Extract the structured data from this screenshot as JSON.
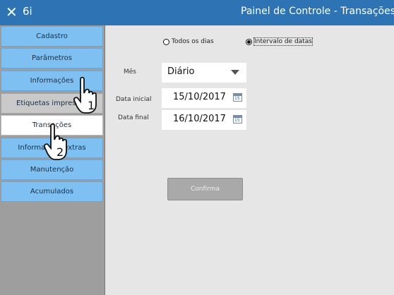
{
  "titlebar": {
    "close_glyph": "✕",
    "app_name": "6i",
    "window_title": "Painel de Controle - Transações"
  },
  "sidebar": {
    "items": [
      {
        "label": "Cadastro",
        "state": "normal"
      },
      {
        "label": "Parâmetros",
        "state": "normal"
      },
      {
        "label": "Informações",
        "state": "normal"
      },
      {
        "label": "Etiquetas impressas",
        "state": "gray"
      },
      {
        "label": "Transações",
        "state": "selected"
      },
      {
        "label": "Informações extras",
        "state": "normal"
      },
      {
        "label": "Manutenção",
        "state": "normal"
      },
      {
        "label": "Acumulados",
        "state": "normal"
      }
    ]
  },
  "filters": {
    "radio_all_days": "Todos os dias",
    "radio_date_range": "Intervalo de datas",
    "selected": "Intervalo de datas"
  },
  "form": {
    "month_label": "Mês",
    "month_value": "Diário",
    "start_label": "Data inicial",
    "start_value": "15/10/2017",
    "end_label": "Data final",
    "end_value": "16/10/2017",
    "calendar_day": "15"
  },
  "confirm_label": "Confirma",
  "annotations": {
    "step1": "1",
    "step2": "2",
    "icon": "pointing-hand-cursor"
  },
  "colors": {
    "titlebar": "#2e74b5",
    "nav_blue": "#7ec0f2",
    "nav_gray": "#c9c9c9",
    "selected": "#ffffff"
  }
}
